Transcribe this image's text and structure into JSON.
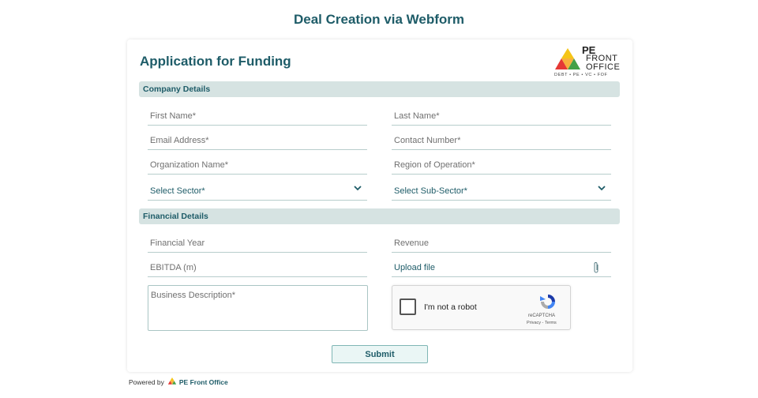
{
  "page": {
    "title": "Deal Creation via Webform"
  },
  "form": {
    "title": "Application for Funding",
    "logo": {
      "line1": "PE",
      "line2": "FRONT",
      "line3": "OFFICE",
      "tagline": "DEBT • PE • VC • FOF"
    },
    "sections": {
      "company": "Company Details",
      "financial": "Financial Details"
    },
    "fields": {
      "first_name": "First Name*",
      "last_name": "Last Name*",
      "email": "Email Address*",
      "contact": "Contact Number*",
      "organization": "Organization Name*",
      "region": "Region of Operation*",
      "sector": "Select Sector*",
      "sub_sector": "Select Sub-Sector*",
      "financial_year": "Financial Year",
      "revenue": "Revenue",
      "ebitda": "EBITDA (m)",
      "upload": "Upload file",
      "business_description": "Business Description*"
    },
    "recaptcha": {
      "label": "I'm not a robot",
      "brand": "reCAPTCHA",
      "terms": "Privacy - Terms"
    },
    "submit_label": "Submit"
  },
  "footer": {
    "powered_by": "Powered by",
    "brand": "PE Front Office"
  },
  "colors": {
    "primary": "#1e5c68",
    "section_bg": "#d6e3e2",
    "logo_yellow": "#f5c518",
    "logo_red": "#e53935",
    "logo_green": "#43a047"
  },
  "icons": {
    "select": "chevron-down-icon",
    "upload": "paperclip-icon",
    "recaptcha": "recaptcha-icon"
  }
}
